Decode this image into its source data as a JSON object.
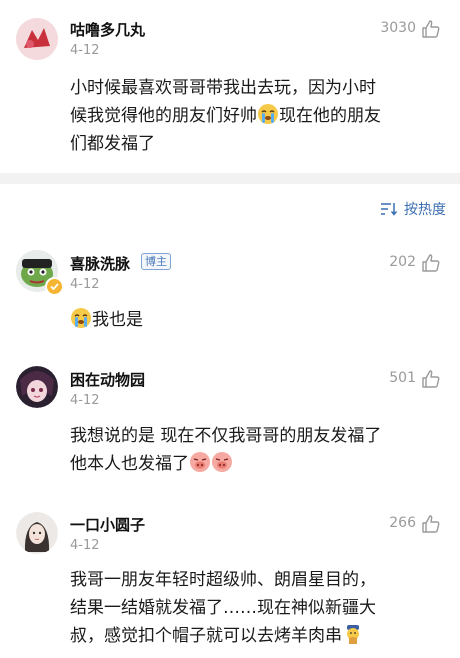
{
  "main_comment": {
    "user": "咕噜多几丸",
    "date": "4-12",
    "likes": "3030",
    "text_line1": "小时候最喜欢哥哥带我出去玩，因为小时",
    "text_line2_a": "候我觉得他的朋友们好帅",
    "text_line2_b": "现在他的朋友",
    "text_line3": "们都发福了"
  },
  "sort": {
    "label": "按热度",
    "icon": "sort-icon"
  },
  "replies": [
    {
      "user": "喜脉洗脉",
      "badge": "博主",
      "date": "4-12",
      "likes": "202",
      "text": "我也是"
    },
    {
      "user": "困在动物园",
      "date": "4-12",
      "likes": "501",
      "text_line1": "我想说的是 现在不仅我哥哥的朋友发福了",
      "text_line2": "他本人也发福了"
    },
    {
      "user": "一口小圆子",
      "date": "4-12",
      "likes": "266",
      "text_line1": "我哥一朋友年轻时超级帅、朗眉星目的，",
      "text_line2": "结果一结婚就发福了……现在神似新疆大",
      "text_line3": "叔，感觉扣个帽子就可以去烤羊肉串"
    }
  ],
  "colors": {
    "accent": "#3a6fb0",
    "muted": "#9a9a9a",
    "divider": "#f2f2f2"
  }
}
